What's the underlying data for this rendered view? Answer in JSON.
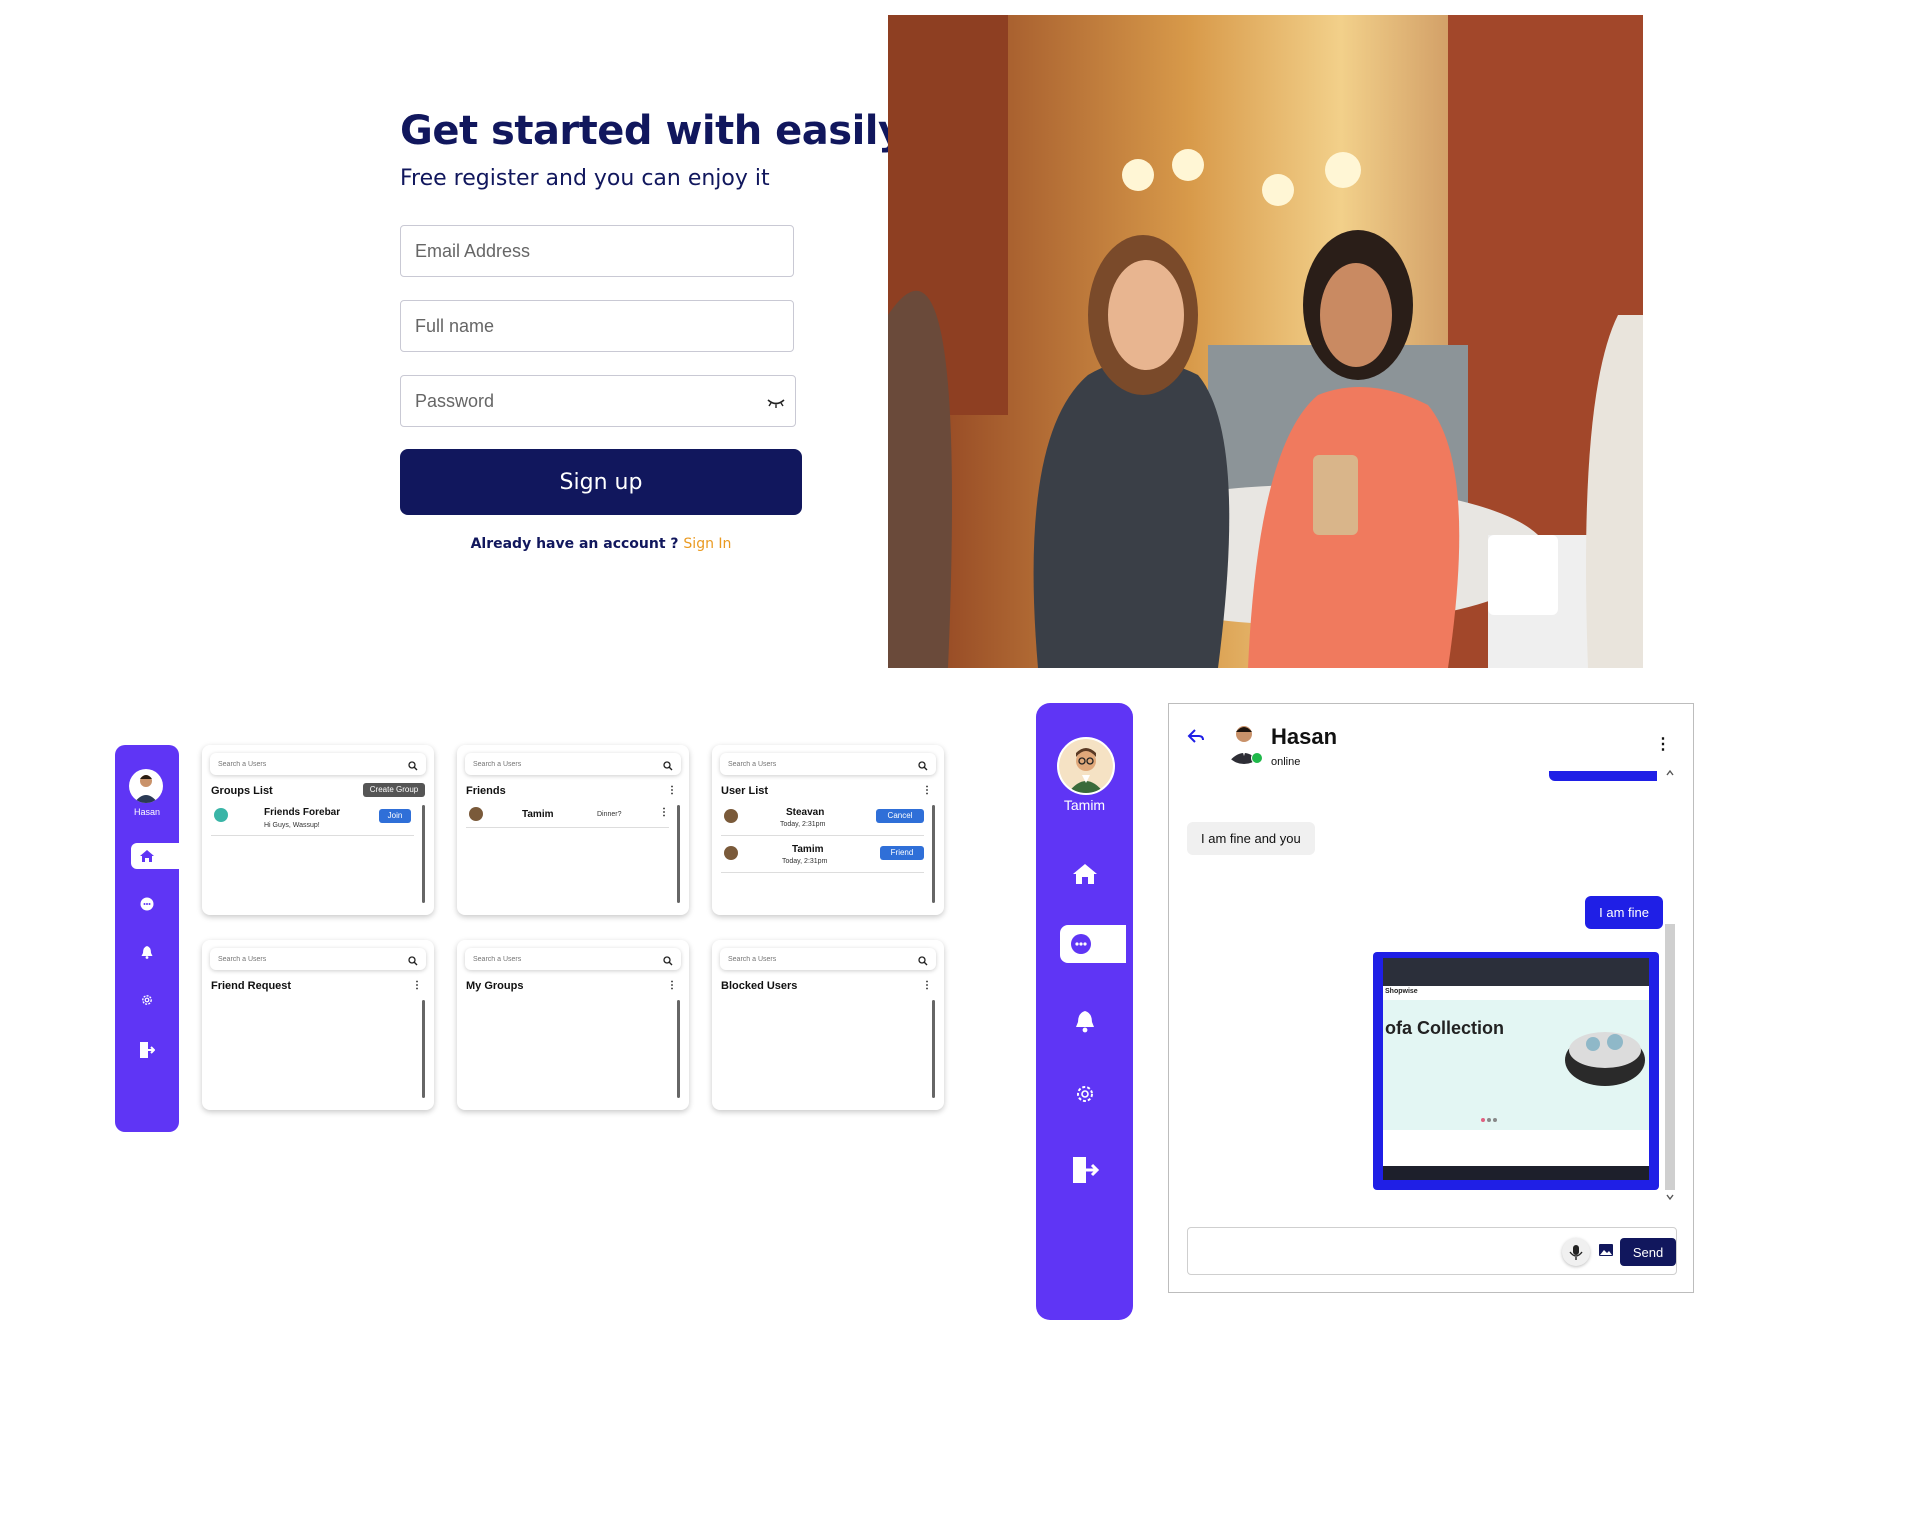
{
  "register": {
    "title": "Get started with easily register",
    "subtitle": "Free register and you can enjoy it",
    "email_placeholder": "Email Address",
    "fullname_placeholder": "Full name",
    "password_placeholder": "Password",
    "signup_label": "Sign up",
    "already_text": "Already have an account ?",
    "signin_label": "Sign In"
  },
  "mini_sidebar": {
    "user_name": "Hasan"
  },
  "cards": {
    "search_placeholder": "Search a Users",
    "groups": {
      "title": "Groups List",
      "create_label": "Create Group",
      "item_name": "Friends Forebar",
      "item_sub": "Hi Guys, Wassup!",
      "join_label": "Join"
    },
    "friends": {
      "title": "Friends",
      "item_name": "Tamim",
      "item_msg": "Dinner?"
    },
    "users": {
      "title": "User List",
      "row1_name": "Steavan",
      "row1_time": "Today, 2:31pm",
      "row1_btn": "Cancel",
      "row2_name": "Tamim",
      "row2_time": "Today, 2:31pm",
      "row2_btn": "Friend"
    },
    "requests": {
      "title": "Friend Request"
    },
    "mygroups": {
      "title": "My Groups"
    },
    "blocked": {
      "title": "Blocked Users"
    }
  },
  "big_sidebar": {
    "user_name": "Tamim"
  },
  "chat": {
    "name": "Hasan",
    "status": "online",
    "msg_received": "I am fine and you",
    "msg_sent": "I am fine",
    "image_shop_name": "Shopwise",
    "image_heading": "ofa Collection",
    "send_label": "Send"
  },
  "colors": {
    "primary": "#5f35f5",
    "navy": "#11175d",
    "accent": "#ea9a21",
    "chat_blue": "#1f1fe6"
  }
}
